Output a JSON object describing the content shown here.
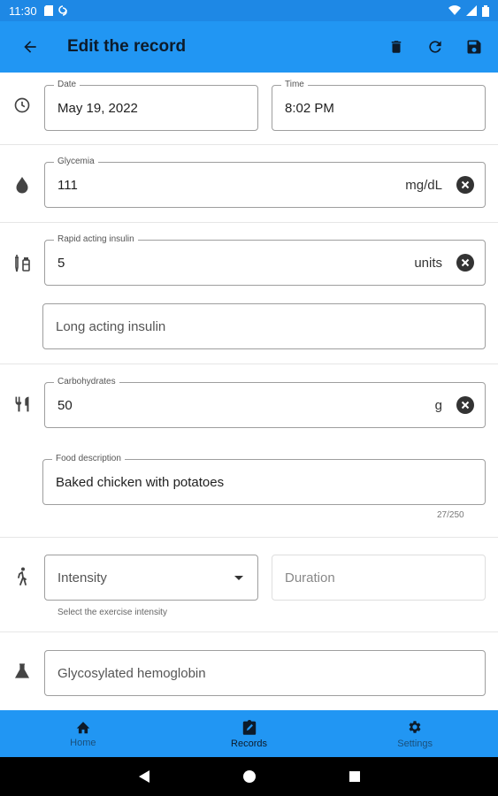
{
  "status_bar": {
    "time": "11:30"
  },
  "app_bar": {
    "title": "Edit the record"
  },
  "datetime": {
    "date_label": "Date",
    "date_value": "May 19, 2022",
    "time_label": "Time",
    "time_value": "8:02 PM"
  },
  "glycemia": {
    "label": "Glycemia",
    "value": "111",
    "unit": "mg/dL"
  },
  "insulin": {
    "rapid_label": "Rapid acting insulin",
    "rapid_value": "5",
    "rapid_unit": "units",
    "long_placeholder": "Long acting insulin"
  },
  "food": {
    "carbs_label": "Carbohydrates",
    "carbs_value": "50",
    "carbs_unit": "g",
    "desc_label": "Food description",
    "desc_value": "Baked chicken with potatoes",
    "counter": "27/250"
  },
  "exercise": {
    "intensity_placeholder": "Intensity",
    "intensity_helper": "Select the exercise intensity",
    "duration_placeholder": "Duration"
  },
  "hba1c": {
    "placeholder": "Glycosylated hemoglobin"
  },
  "bottom_nav": {
    "items": [
      {
        "label": "Home"
      },
      {
        "label": "Records"
      },
      {
        "label": "Settings"
      }
    ],
    "active": "Records"
  }
}
